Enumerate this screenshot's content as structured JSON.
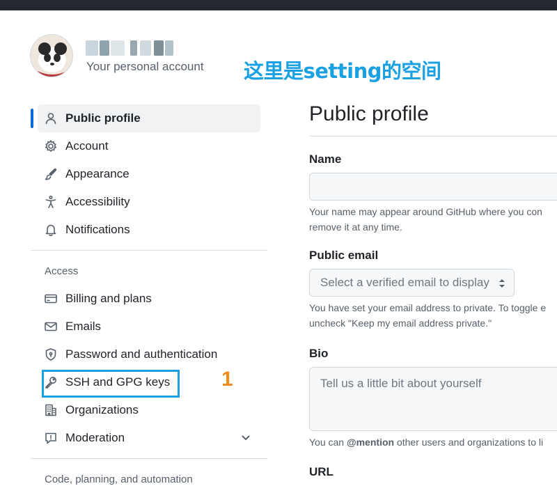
{
  "header": {
    "account_subtitle": "Your personal account",
    "annotation": "这里是setting的空间"
  },
  "sidebar": {
    "items": [
      {
        "label": "Public profile",
        "icon": "person-icon",
        "active": true
      },
      {
        "label": "Account",
        "icon": "gear-icon"
      },
      {
        "label": "Appearance",
        "icon": "paintbrush-icon"
      },
      {
        "label": "Accessibility",
        "icon": "accessibility-icon"
      },
      {
        "label": "Notifications",
        "icon": "bell-icon"
      }
    ],
    "access_heading": "Access",
    "access_items": [
      {
        "label": "Billing and plans",
        "icon": "credit-card-icon"
      },
      {
        "label": "Emails",
        "icon": "mail-icon"
      },
      {
        "label": "Password and authentication",
        "icon": "shield-lock-icon"
      },
      {
        "label": "SSH and GPG keys",
        "icon": "key-icon"
      },
      {
        "label": "Organizations",
        "icon": "organization-icon"
      },
      {
        "label": "Moderation",
        "icon": "report-icon"
      }
    ],
    "code_heading": "Code, planning, and automation"
  },
  "annotation_number": "1",
  "main": {
    "title": "Public profile",
    "name_label": "Name",
    "name_note_1": "Your name may appear around GitHub where you con",
    "name_note_2": "remove it at any time.",
    "email_label": "Public email",
    "email_select": "Select a verified email to display",
    "email_note_1": "You have set your email address to private. To toggle e",
    "email_note_2": "uncheck \"Keep my email address private.\"",
    "bio_label": "Bio",
    "bio_placeholder": "Tell us a little bit about yourself",
    "bio_note_prefix": "You can ",
    "bio_note_mention": "@mention",
    "bio_note_suffix": " other users and organizations to li",
    "url_label": "URL"
  },
  "colors": {
    "accent": "#0969da",
    "annotation_blue": "#1ba1e2",
    "annotation_orange": "#f28a1e"
  }
}
